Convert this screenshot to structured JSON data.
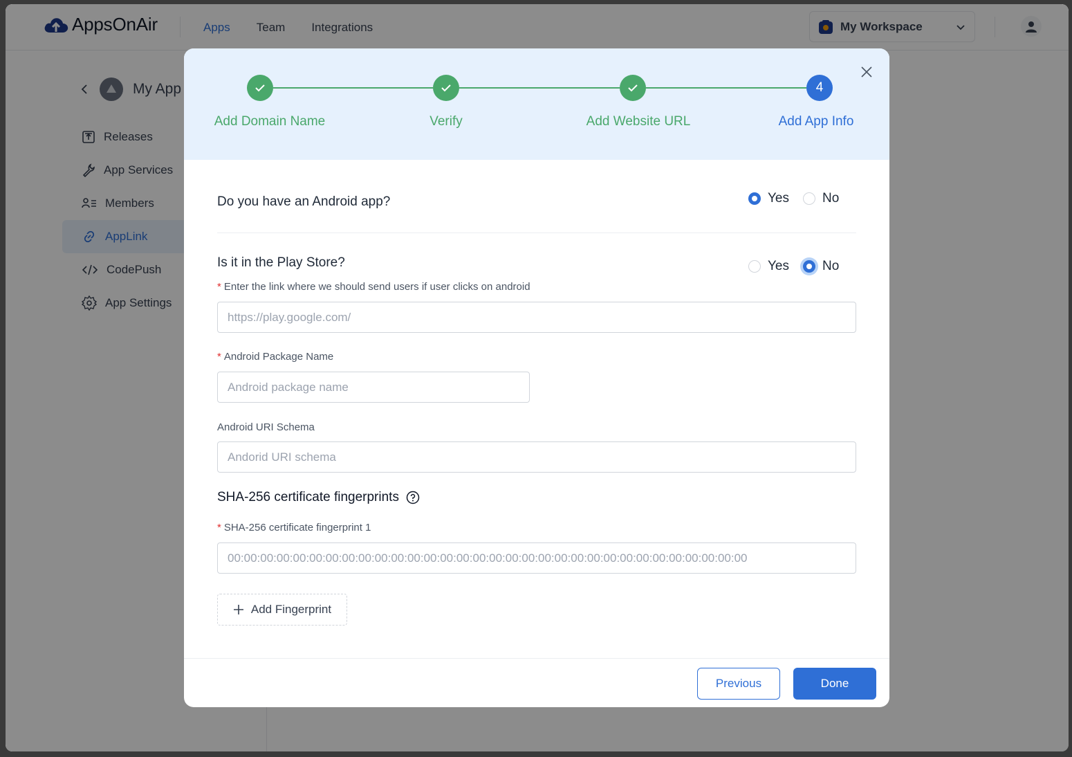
{
  "header": {
    "brand": "AppsOnAir",
    "nav": [
      "Apps",
      "Team",
      "Integrations"
    ],
    "active_nav": "Apps",
    "workspace": "My Workspace"
  },
  "sidebar": {
    "app_title": "My App",
    "items": [
      {
        "label": "Releases",
        "icon": "release-upload-icon"
      },
      {
        "label": "App Services",
        "icon": "wrench-icon"
      },
      {
        "label": "Members",
        "icon": "members-list-icon"
      },
      {
        "label": "AppLink",
        "icon": "link-icon"
      },
      {
        "label": "CodePush",
        "icon": "code-icon"
      },
      {
        "label": "App Settings",
        "icon": "gear-icon"
      }
    ],
    "active_item": "AppLink"
  },
  "stepper": {
    "steps": [
      {
        "label": "Add Domain Name",
        "status": "done"
      },
      {
        "label": "Verify",
        "status": "done"
      },
      {
        "label": "Add Website URL",
        "status": "done"
      },
      {
        "label": "Add App Info",
        "status": "current",
        "number": "4"
      }
    ]
  },
  "form": {
    "android_question": "Do you have an Android app?",
    "android_options": {
      "yes": "Yes",
      "no": "No",
      "selected": "Yes"
    },
    "playstore_question": "Is it in the Play Store?",
    "playstore_options": {
      "yes": "Yes",
      "no": "No",
      "selected": "No"
    },
    "link_label": "Enter the link where we should send users if user clicks on android",
    "link_placeholder": "https://play.google.com/",
    "package_label": "Android Package Name",
    "package_placeholder": "Android package name",
    "uri_label": "Android URI Schema",
    "uri_placeholder": "Andorid URI schema",
    "sha_title": "SHA-256 certificate fingerprints",
    "sha_field_label": "SHA-256 certificate fingerprint 1",
    "sha_placeholder": "00:00:00:00:00:00:00:00:00:00:00:00:00:00:00:00:00:00:00:00:00:00:00:00:00:00:00:00:00:00:00:00",
    "add_fingerprint": "Add Fingerprint"
  },
  "buttons": {
    "previous": "Previous",
    "done": "Done"
  },
  "colors": {
    "accent": "#2f6fd6",
    "success": "#4aa86b",
    "stepper_bg": "#e6f1fd"
  }
}
